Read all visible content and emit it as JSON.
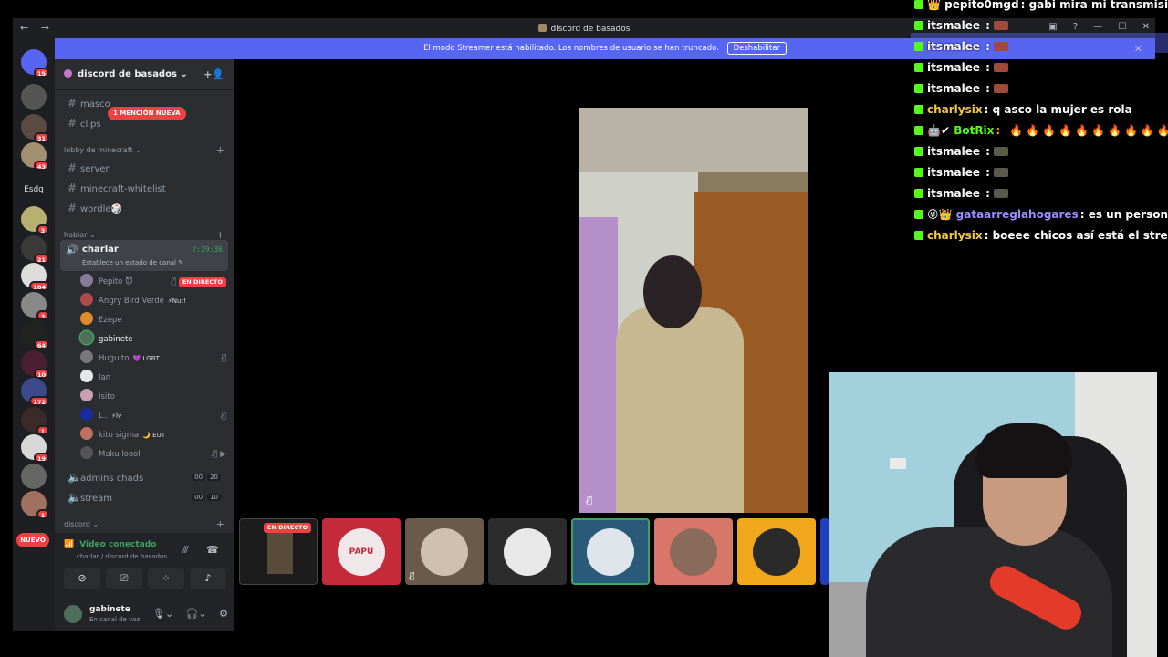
{
  "window": {
    "title": "discord de basados",
    "nav_back": "←",
    "nav_forward": "→",
    "controls": [
      "▣",
      "?",
      "—",
      "☐",
      "✕"
    ]
  },
  "streamer_bar": {
    "text": "El modo Streamer está habilitado. Los nombres de usuario se han truncado.",
    "button": "Deshabilitar",
    "close": "✕"
  },
  "rail": {
    "badges": [
      "15",
      "31",
      "43",
      "3",
      "21",
      "184",
      "3",
      "64",
      "10",
      "172",
      "1",
      "19",
      "1"
    ],
    "label_esdg": "Esdg",
    "nuevo": "NUEVO"
  },
  "guild": {
    "name": "discord de basados",
    "chevron": "⌄",
    "add_user_icon": "person-add-icon"
  },
  "channels": {
    "mascot": "masco",
    "mention_badge": "1 MENCIÓN NUEVA",
    "clips": "clips",
    "category_minecraft": "lobby de minecraft",
    "server": "server",
    "whitelist": "minecraft-whitelist",
    "wordle": "wordle🎲",
    "category_hablar": "hablar",
    "charlar": "charlar",
    "charlar_time": "2:29:36",
    "charlar_status": "Establece un estado de canal ✎",
    "admins": "admins chads",
    "admins_counts": [
      "00",
      "20"
    ],
    "stream": "stream",
    "stream_counts": [
      "00",
      "10"
    ],
    "category_discord": "discord"
  },
  "voice_users": [
    {
      "name": "Pepito 😈",
      "live": "EN DIRECTO",
      "color": "#8a7a9a"
    },
    {
      "name": "Angry Bird Verde",
      "tag": "⚡Nut!",
      "color": "#b04a4a"
    },
    {
      "name": "Ezepe",
      "color": "#e08a2a"
    },
    {
      "name": "gabinete",
      "color": "#4f6f5a"
    },
    {
      "name": "Huguito",
      "tag": "💜 LGBT",
      "color": "#777"
    },
    {
      "name": "Ian",
      "color": "#e6e6e6"
    },
    {
      "name": "Isito",
      "color": "#c8a0b0"
    },
    {
      "name": "L..",
      "tag": "⚡lv",
      "color": "#1a2aa0"
    },
    {
      "name": "kito sigma",
      "tag": "🌙 EUT",
      "color": "#c07060"
    },
    {
      "name": "Maku loool",
      "color": "#555"
    }
  ],
  "voice_panel": {
    "status": "Video conectado",
    "location": "charlar / discord de basados",
    "user": "gabinete",
    "user_status": "En canal de voz"
  },
  "stage": {
    "live_badge": "EN DIRECTO",
    "tile_colors": [
      "#1c1c1c",
      "#c42a3a",
      "#6a5a4a",
      "#2c2c2c",
      "#2a5a7a",
      "#d8766a",
      "#f0a81a"
    ],
    "tile_pink_label": "PAPU"
  },
  "chat": [
    {
      "user": "pepito0mgd",
      "color": "#ffffff",
      "msg": ": gabi mira mi transmision"
    },
    {
      "user": "itsmalee",
      "color": "#ffffff",
      "msg": " :"
    },
    {
      "user": "itsmalee",
      "color": "#ffffff",
      "msg": " :"
    },
    {
      "user": "itsmalee",
      "color": "#ffffff",
      "msg": " :"
    },
    {
      "user": "itsmalee",
      "color": "#ffffff",
      "msg": " :"
    },
    {
      "user": "charlysix",
      "color": "#f5c842",
      "msg": ": q asco la mujer es rola"
    },
    {
      "user": "BotRix",
      "color": "#53fc18",
      "msg": ": 🔥🔥🔥🔥🔥🔥🔥🔥🔥🔥"
    },
    {
      "user": "itsmalee",
      "color": "#ffffff",
      "msg": " :"
    },
    {
      "user": "itsmalee",
      "color": "#ffffff",
      "msg": " :"
    },
    {
      "user": "itsmalee",
      "color": "#ffffff",
      "msg": " :"
    },
    {
      "user": "gataarreglahogares",
      "color": "#9b8cff",
      "msg": ": es un personaje de"
    },
    {
      "user": "charlysix",
      "color": "#f5c842",
      "msg": ": boeee chicos así está el stream d"
    }
  ],
  "colors": {
    "blurple": "#5865f2",
    "live_red": "#f23f43",
    "voice_green": "#3ba55d",
    "kick_green": "#53fc18"
  }
}
